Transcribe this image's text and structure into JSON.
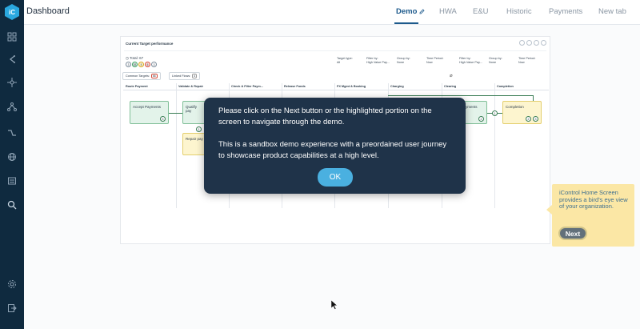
{
  "header": {
    "title": "Dashboard",
    "tabs": [
      {
        "label": "Demo",
        "active": true
      },
      {
        "label": "HWA"
      },
      {
        "label": "E&U"
      },
      {
        "label": "Historic"
      },
      {
        "label": "Payments"
      },
      {
        "label": "New tab"
      }
    ]
  },
  "panel": {
    "title": "Current Target performance",
    "total": "Total: 67",
    "badges": [
      "3",
      "53",
      "5",
      "6",
      "3"
    ],
    "filters": [
      {
        "k": "Target type:",
        "v": "All"
      },
      {
        "k": "Filter by:",
        "v": "High Value Pay..."
      },
      {
        "k": "Group by:",
        "v": "None"
      },
      {
        "k": "Time Period:",
        "v": "Now"
      },
      {
        "k": "Filter by:",
        "v": "High Value Pay..."
      },
      {
        "k": "Group by:",
        "v": "None"
      },
      {
        "k": "Time Period:",
        "v": "Now"
      }
    ],
    "common_targets": {
      "label": "Common Targets:",
      "count": "66"
    },
    "linked_flows": {
      "label": "Linked Flows:",
      "count": "4"
    },
    "columns": [
      "Route Payment",
      "Validate & Repair",
      "Check & Filter Paym...",
      "Release Funds",
      "FX Mgmt & Booking",
      "Charging",
      "Clearing",
      "Completion"
    ],
    "nodes": {
      "accept_payments": {
        "label": "Accept Payments",
        "count": "5"
      },
      "qualify": {
        "label": "Qualify pay"
      },
      "repair": {
        "label": "Repair pay",
        "count": "1"
      },
      "clearing": {
        "label": "yments",
        "count": "2"
      },
      "completion": {
        "label": "Completion",
        "counts": [
          "2",
          "3"
        ]
      },
      "connector_count": "1"
    }
  },
  "modal": {
    "line1": "Please click on the Next button or the highlighted portion on the screen to navigate through the demo.",
    "line2": "This is a sandbox demo experience with a preordained user journey to showcase product capabilities at a high level.",
    "ok_label": "OK"
  },
  "tooltip": {
    "text": "iControl Home Screen provides a bird's eye view of your organization.",
    "next_label": "Next"
  },
  "colors": {
    "sidebar": "#0f2a3f",
    "active_tab": "#1d5a8c",
    "modal_bg": "#1f3349",
    "ok_button": "#4ab0e0",
    "tooltip_bg": "#fbe7a5",
    "node_green": "#e3f3ea",
    "node_yellow": "#fdf5cf"
  }
}
